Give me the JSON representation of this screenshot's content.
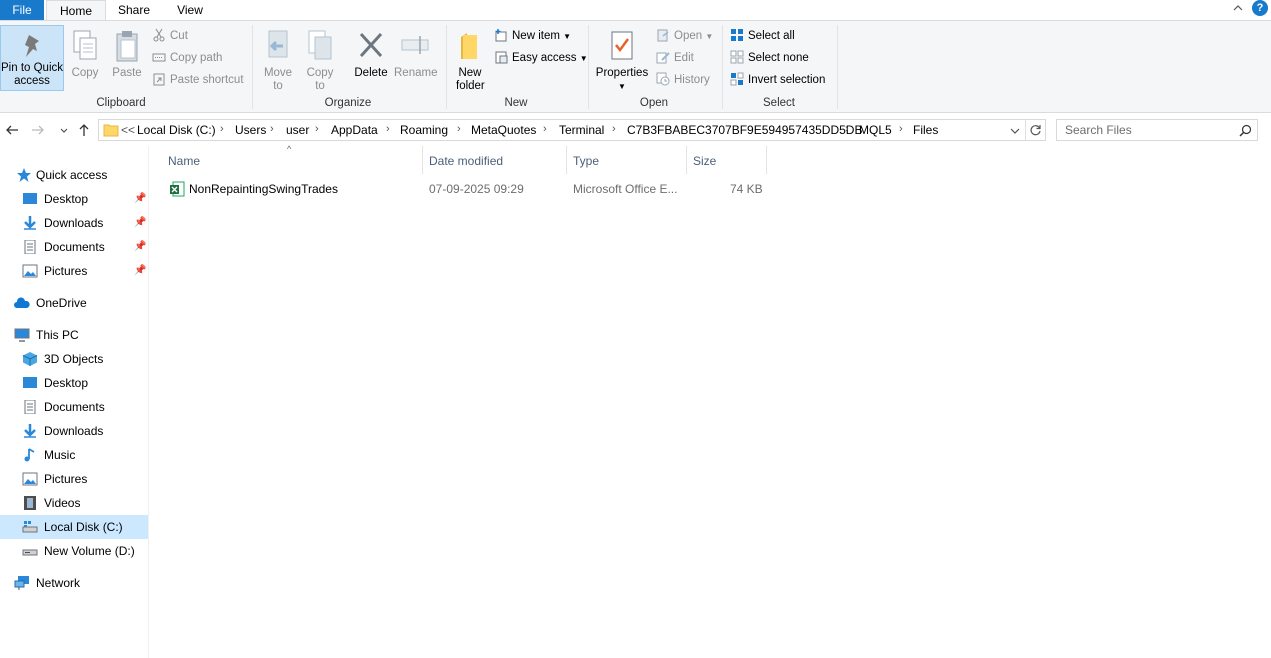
{
  "tabs": {
    "file": "File",
    "home": "Home",
    "share": "Share",
    "view": "View"
  },
  "ribbon": {
    "clipboard": {
      "pin": "Pin to Quick access",
      "copy": "Copy",
      "paste": "Paste",
      "cut": "Cut",
      "copy_path": "Copy path",
      "paste_shortcut": "Paste shortcut",
      "label": "Clipboard"
    },
    "organize": {
      "move_to": "Move to",
      "copy_to": "Copy to",
      "delete": "Delete",
      "rename": "Rename",
      "label": "Organize"
    },
    "new": {
      "new_folder": "New folder",
      "new_item": "New item",
      "easy_access": "Easy access",
      "label": "New"
    },
    "open": {
      "properties": "Properties",
      "open": "Open",
      "edit": "Edit",
      "history": "History",
      "label": "Open"
    },
    "select": {
      "select_all": "Select all",
      "select_none": "Select none",
      "invert_selection": "Invert selection",
      "label": "Select"
    }
  },
  "address": {
    "overflow": "<<",
    "crumbs": [
      "Local Disk (C:)",
      "Users",
      "user",
      "AppData",
      "Roaming",
      "MetaQuotes",
      "Terminal",
      "C7B3FBABEC3707BF9E594957435DD5DB",
      "MQL5",
      "Files"
    ],
    "search_placeholder": "Search Files"
  },
  "sidebar": {
    "quick_access": "Quick access",
    "quick_items": [
      "Desktop",
      "Downloads",
      "Documents",
      "Pictures"
    ],
    "onedrive": "OneDrive",
    "this_pc": "This PC",
    "pc_items": [
      "3D Objects",
      "Desktop",
      "Documents",
      "Downloads",
      "Music",
      "Pictures",
      "Videos",
      "Local Disk (C:)",
      "New Volume (D:)"
    ],
    "network": "Network"
  },
  "columns": {
    "name": "Name",
    "date": "Date modified",
    "type": "Type",
    "size": "Size"
  },
  "files": [
    {
      "name": "NonRepaintingSwingTrades",
      "date": "07-09-2025 09:29",
      "type": "Microsoft Office E...",
      "size": "74 KB"
    }
  ],
  "colors": {
    "accent": "#1979ca",
    "selected": "#cce8ff",
    "ribbon_bg": "#f5f6f7"
  }
}
